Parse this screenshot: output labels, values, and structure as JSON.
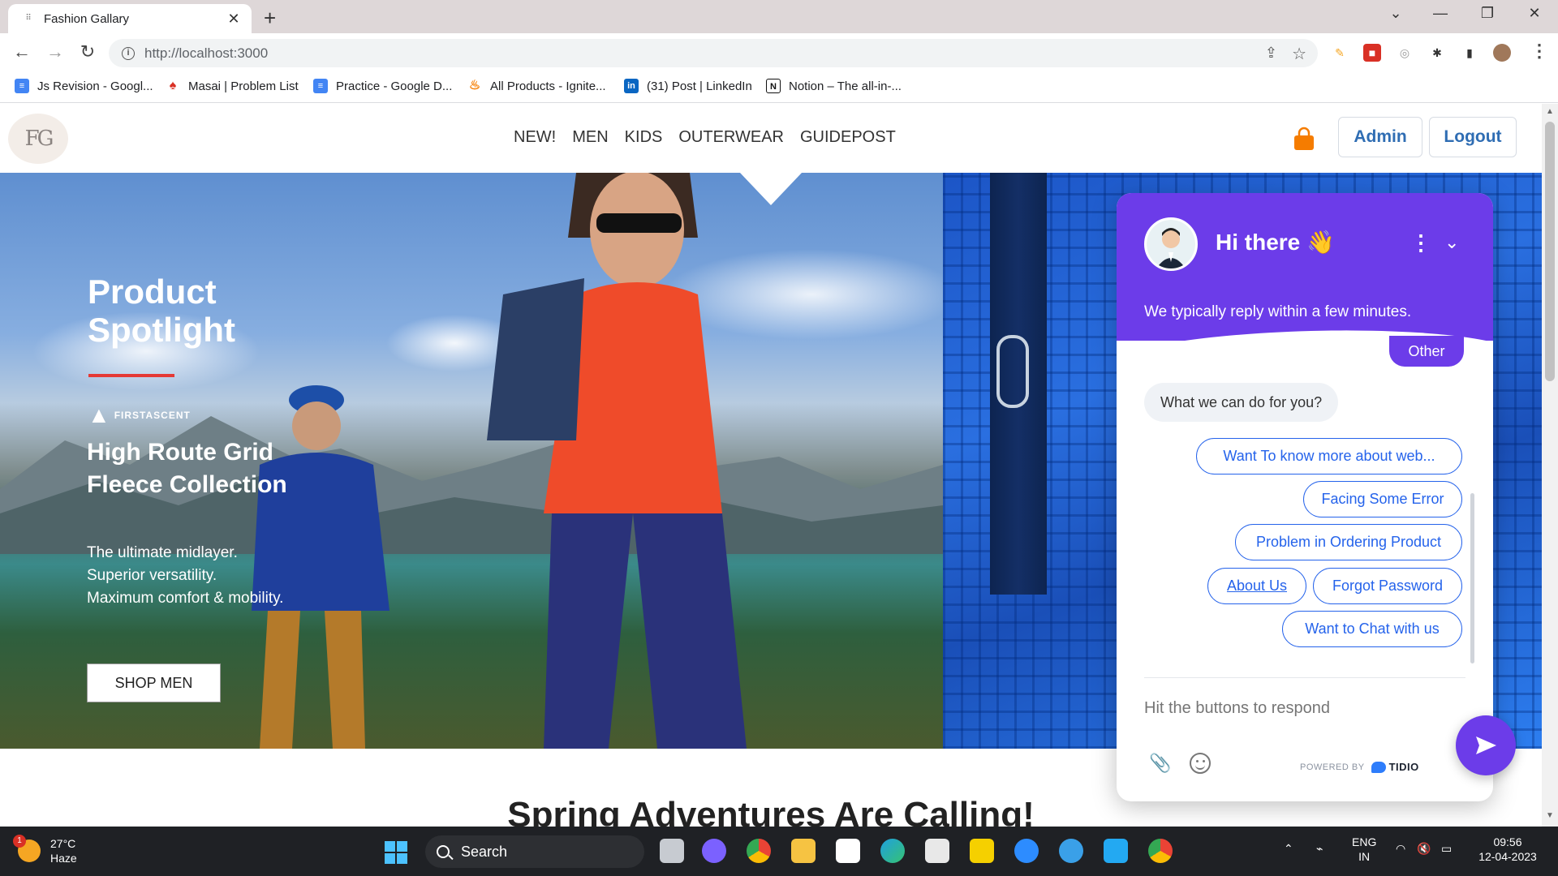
{
  "browser": {
    "tab_title": "Fashion Gallary",
    "url": "http://localhost:3000",
    "bookmarks": [
      {
        "label": "Js Revision - Googl...",
        "icon": "google-docs-icon",
        "color": "#4285f4"
      },
      {
        "label": "Masai | Problem List",
        "icon": "masai-icon",
        "color": "#d93025"
      },
      {
        "label": "Practice - Google D...",
        "icon": "google-docs-icon",
        "color": "#4285f4"
      },
      {
        "label": "All Products - Ignite...",
        "icon": "fire-icon",
        "color": "#f57c00"
      },
      {
        "label": "(31) Post | LinkedIn",
        "icon": "linkedin-icon",
        "color": "#0a66c2"
      },
      {
        "label": "Notion – The all-in-...",
        "icon": "notion-icon",
        "color": "#111111"
      }
    ]
  },
  "site": {
    "logo_text": "FG",
    "nav": [
      "NEW!",
      "MEN",
      "KIDS",
      "OUTERWEAR",
      "GUIDEPOST"
    ],
    "admin_label": "Admin",
    "logout_label": "Logout",
    "accent_color": "#2f6db3",
    "bag_color": "#f57c00"
  },
  "hero": {
    "spotlight": "Product Spotlight",
    "brand": "FIRSTASCENT",
    "collection": "High Route Grid Fleece Collection",
    "tagline_lines": [
      "The ultimate midlayer.",
      "Superior versatility.",
      "Maximum comfort & mobility."
    ],
    "cta": "SHOP MEN"
  },
  "section_title": "Spring Adventures Are Calling!",
  "chat": {
    "greeting": "Hi there 👋",
    "reply_note": "We typically reply within a few minutes.",
    "user_chip": "Other",
    "bot_message": "What we can do for you?",
    "quick_replies": [
      "Want To know more about web...",
      "Facing Some Error",
      "Problem in Ordering Product",
      "About Us",
      "Forgot Password",
      "Want to Chat with us"
    ],
    "input_placeholder": "Hit the buttons to respond",
    "powered_by": "POWERED BY",
    "vendor": "TIDIO",
    "theme_color": "#6c3ce9",
    "link_color": "#2563eb"
  },
  "taskbar": {
    "weather_temp": "27°C",
    "weather_desc": "Haze",
    "weather_badge": "1",
    "search_label": "Search",
    "lang_top": "ENG",
    "lang_bottom": "IN",
    "time": "09:56",
    "date": "12-04-2023"
  }
}
